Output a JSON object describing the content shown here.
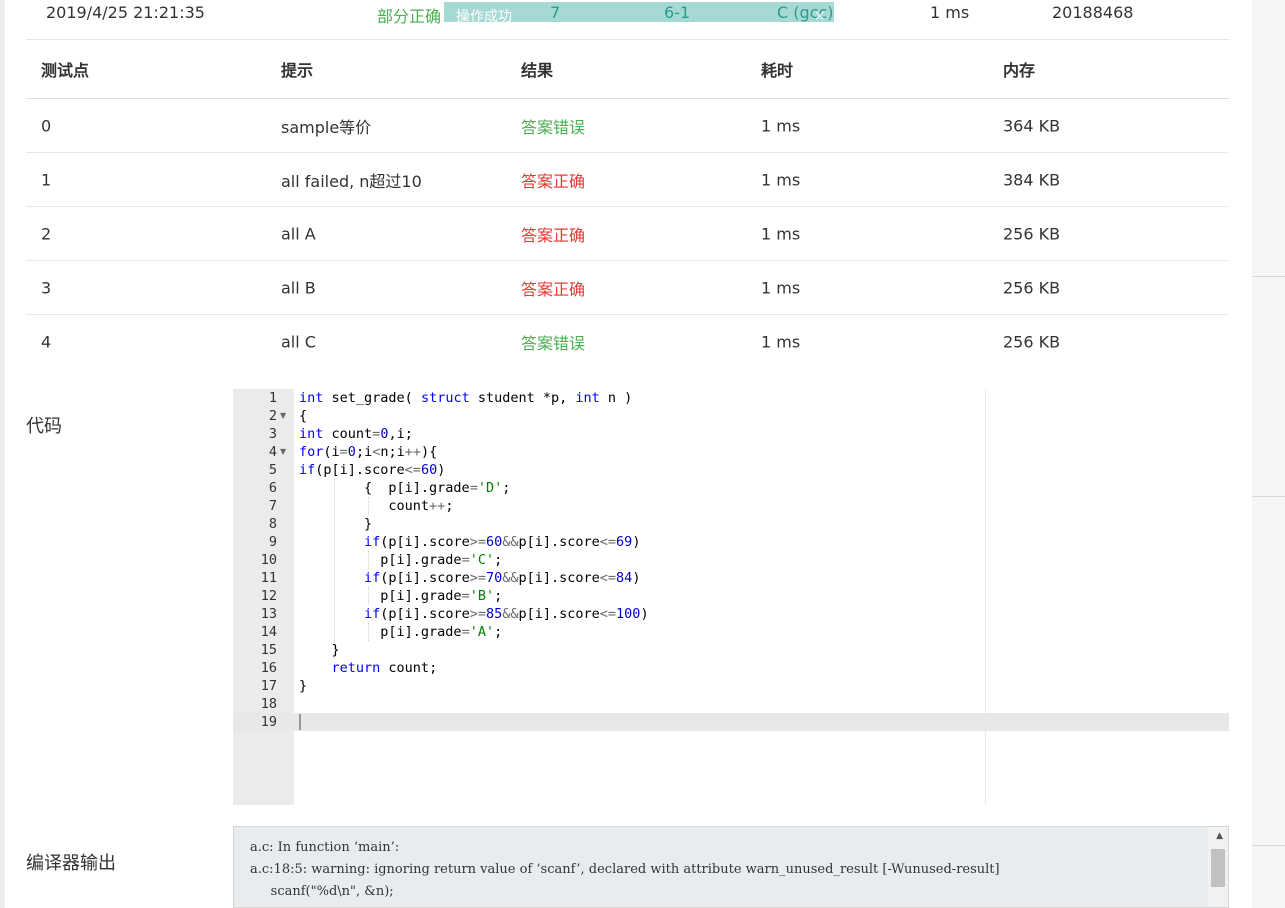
{
  "submission": {
    "time": "2019/4/25 21:21:35",
    "status": "部分正确",
    "toast": "操作成功",
    "problem": "7",
    "problem_id": "6-1",
    "language": "C (gcc)",
    "toast_close": "×",
    "duration": "1 ms",
    "user": "20188468"
  },
  "testcases": {
    "headers": [
      "测试点",
      "提示",
      "结果",
      "耗时",
      "内存"
    ],
    "rows": [
      {
        "id": "0",
        "hint": "sample等价",
        "result": "答案错误",
        "time": "1 ms",
        "memory": "364 KB",
        "color": "#4caf50"
      },
      {
        "id": "1",
        "hint": "all failed, n超过10",
        "result": "答案正确",
        "time": "1 ms",
        "memory": "384 KB",
        "color": "#e53935"
      },
      {
        "id": "2",
        "hint": "all A",
        "result": "答案正确",
        "time": "1 ms",
        "memory": "256 KB",
        "color": "#e53935"
      },
      {
        "id": "3",
        "hint": "all B",
        "result": "答案正确",
        "time": "1 ms",
        "memory": "256 KB",
        "color": "#e53935"
      },
      {
        "id": "4",
        "hint": "all C",
        "result": "答案错误",
        "time": "1 ms",
        "memory": "256 KB",
        "color": "#4caf50"
      }
    ]
  },
  "code_label": "代码",
  "code": {
    "line_numbers": [
      "1",
      "2",
      "3",
      "4",
      "5",
      "6",
      "7",
      "8",
      "9",
      "10",
      "11",
      "12",
      "13",
      "14",
      "15",
      "16",
      "17",
      "18",
      "19"
    ],
    "fold_lines": [
      "2",
      "4"
    ]
  },
  "compiler_label": "编译器输出",
  "compiler_output": [
    "a.c: In function ‘main’:",
    "a.c:18:5: warning: ignoring return value of ‘scanf’, declared with attribute warn_unused_result [-Wunused-result]",
    "     scanf(\"%d\\n\", &n);",
    "     ^~~~~~~~~~~~~~~~~"
  ],
  "colors": {
    "correct": "#e53935",
    "wrong": "#4caf50",
    "status_partial": "#4caf50",
    "link": "#2a9d8f",
    "keyword": "#0000ff"
  }
}
